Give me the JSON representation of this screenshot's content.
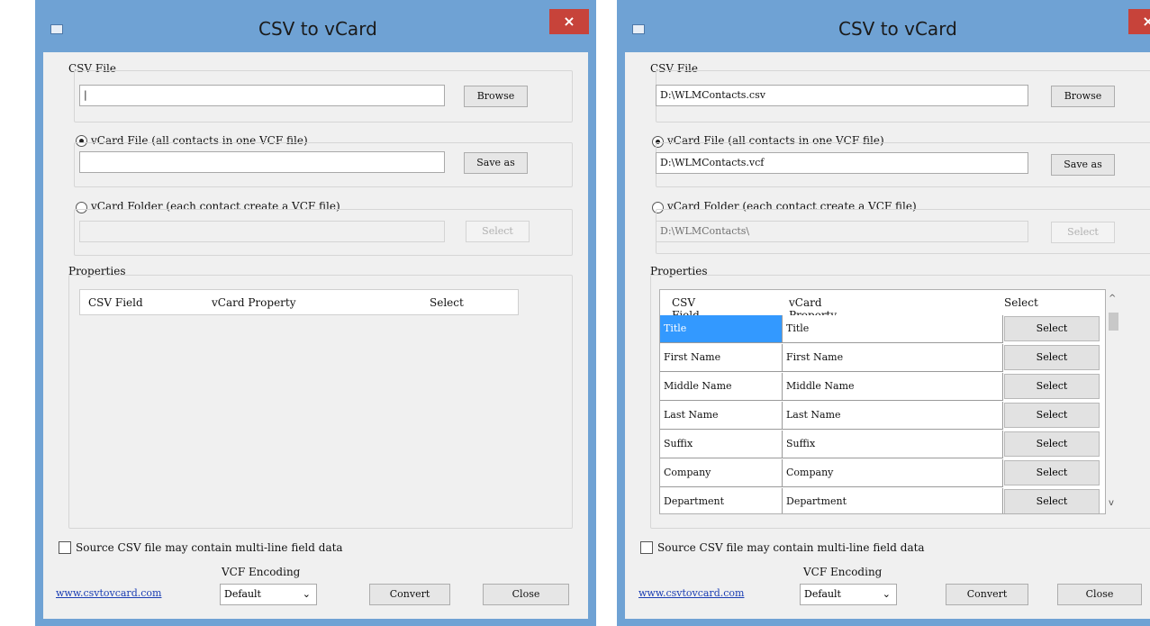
{
  "left": {
    "title": "CSV to vCard",
    "close": "×",
    "csv_file": {
      "label": "CSV File",
      "value": "|",
      "browse": "Browse"
    },
    "vcard_file": {
      "label": "vCard File (all contacts in one VCF file)",
      "value": "",
      "button": "Save as",
      "selected": true
    },
    "vcard_folder": {
      "label": "vCard Folder (each contact create a VCF file)",
      "value": "",
      "button": "Select",
      "selected": false
    },
    "properties": {
      "label": "Properties",
      "columns": [
        "CSV Field",
        "vCard Property",
        "Select"
      ]
    },
    "multiline": {
      "label": "Source CSV file may contain multi-line field data",
      "checked": false
    },
    "website": "www.csvtovcard.com",
    "encoding": {
      "label": "VCF Encoding",
      "value": "Default"
    },
    "convert": "Convert",
    "close_button": "Close"
  },
  "right": {
    "title": "CSV to vCard",
    "close": "×",
    "csv_file": {
      "label": "CSV File",
      "value": "D:\\WLMContacts.csv",
      "browse": "Browse"
    },
    "vcard_file": {
      "label": "vCard File (all contacts in one VCF file)",
      "value": "D:\\WLMContacts.vcf",
      "button": "Save as",
      "selected": true
    },
    "vcard_folder": {
      "label": "vCard Folder (each contact create a VCF file)",
      "value": "D:\\WLMContacts\\",
      "button": "Select",
      "selected": false
    },
    "properties": {
      "label": "Properties",
      "columns": [
        "CSV Field",
        "vCard Property",
        "Select"
      ],
      "rows": [
        {
          "csv": "Title",
          "vcard": "Title",
          "select": "Select"
        },
        {
          "csv": "First Name",
          "vcard": "First Name",
          "select": "Select"
        },
        {
          "csv": "Middle Name",
          "vcard": "Middle Name",
          "select": "Select"
        },
        {
          "csv": "Last Name",
          "vcard": "Last Name",
          "select": "Select"
        },
        {
          "csv": "Suffix",
          "vcard": "Suffix",
          "select": "Select"
        },
        {
          "csv": "Company",
          "vcard": "Company",
          "select": "Select"
        },
        {
          "csv": "Department",
          "vcard": "Department",
          "select": "Select"
        }
      ]
    },
    "multiline": {
      "label": "Source CSV file may contain multi-line field data",
      "checked": false
    },
    "website": "www.csvtovcard.com",
    "encoding": {
      "label": "VCF Encoding",
      "value": "Default"
    },
    "convert": "Convert",
    "close_button": "Close"
  },
  "icons": {
    "combo_arrow": "⌄",
    "scroll_up": "^",
    "scroll_down": "v"
  }
}
